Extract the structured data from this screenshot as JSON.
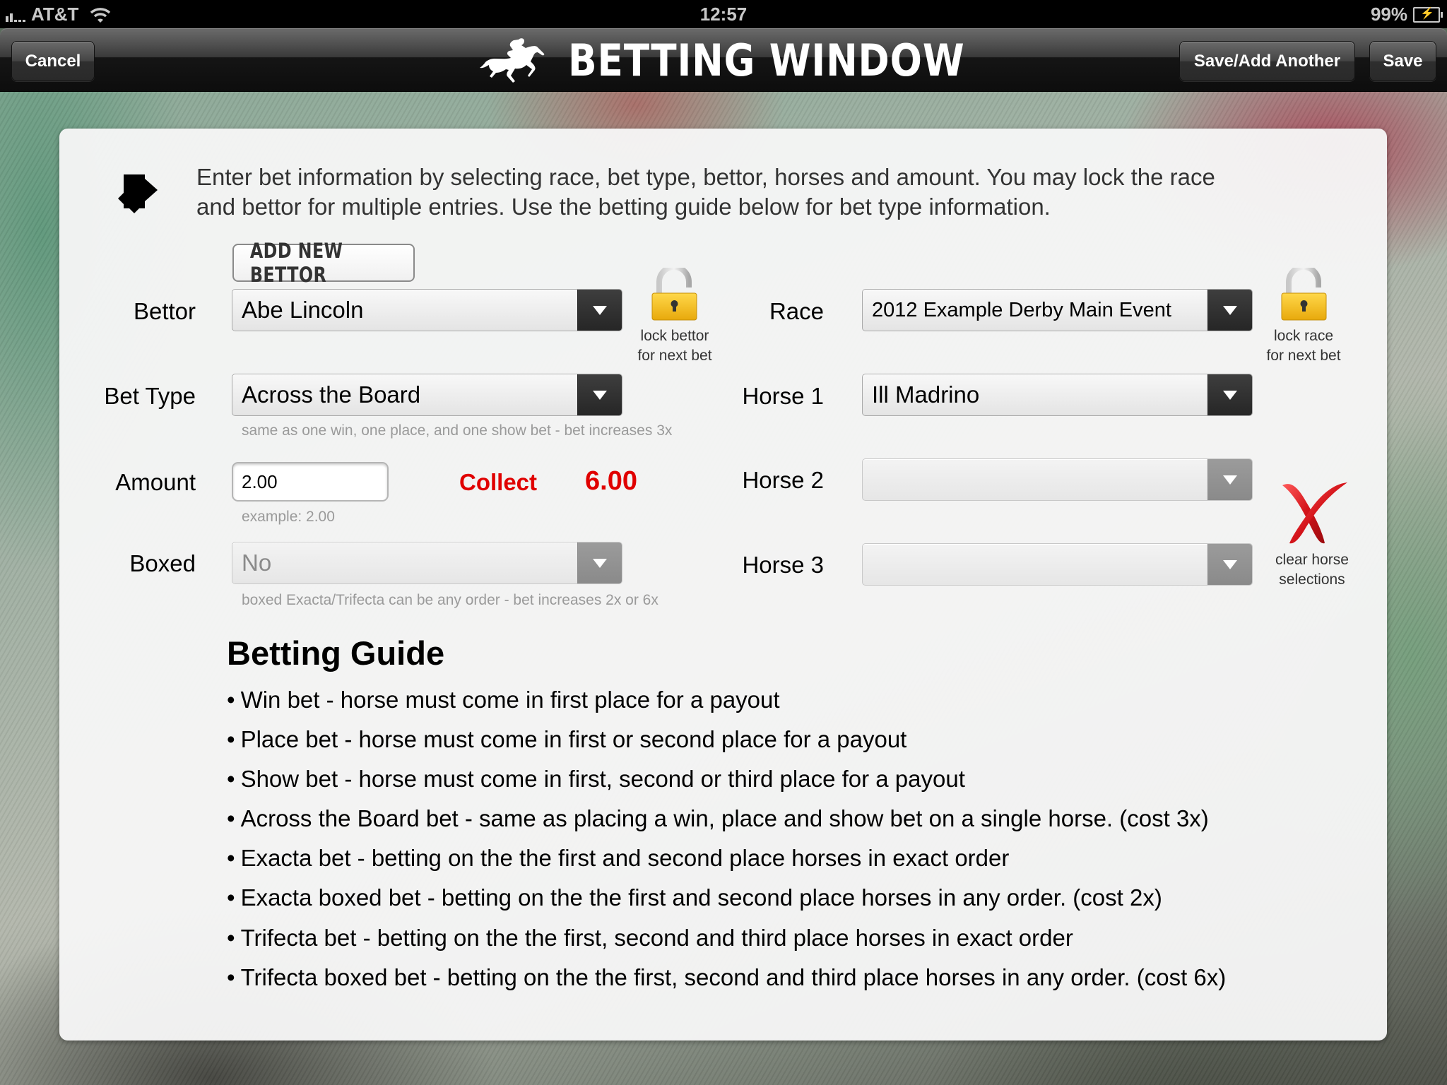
{
  "status_bar": {
    "carrier": "AT&T",
    "time": "12:57",
    "battery": "99%"
  },
  "nav": {
    "cancel_label": "Cancel",
    "title": "BETTING WINDOW",
    "save_add_another_label": "Save/Add Another",
    "save_label": "Save"
  },
  "instructions": {
    "text": "Enter bet information by selecting race, bet type, bettor, horses and amount.  You may lock the race and bettor for multiple entries.  Use the betting guide below for bet type information."
  },
  "form": {
    "add_new_bettor_label": "ADD NEW BETTOR",
    "bettor": {
      "label": "Bettor",
      "value": "Abe Lincoln"
    },
    "lock_bettor": {
      "line1": "lock bettor",
      "line2": "for next bet"
    },
    "bet_type": {
      "label": "Bet Type",
      "value": "Across the Board",
      "helper": "same as one win, one place, and one show bet - bet increases 3x"
    },
    "amount": {
      "label": "Amount",
      "value": "2.00",
      "helper": "example: 2.00"
    },
    "collect": {
      "label": "Collect",
      "value": "6.00"
    },
    "boxed": {
      "label": "Boxed",
      "value": "No",
      "helper": "boxed Exacta/Trifecta can be any order - bet increases 2x or 6x"
    },
    "race": {
      "label": "Race",
      "value": "2012 Example Derby Main Event"
    },
    "lock_race": {
      "line1": "lock race",
      "line2": "for next bet"
    },
    "horse1": {
      "label": "Horse 1",
      "value": "Ill Madrino"
    },
    "horse2": {
      "label": "Horse 2",
      "value": ""
    },
    "horse3": {
      "label": "Horse 3",
      "value": ""
    },
    "clear_horses": {
      "line1": "clear horse",
      "line2": "selections"
    }
  },
  "guide": {
    "title": "Betting Guide",
    "bullet": "•",
    "items": [
      "Win bet - horse must come in first place for a payout",
      "Place bet - horse must come in first or second place for a payout",
      "Show bet - horse must come in first, second or third place for a payout",
      "Across the Board bet - same as placing a win, place and show bet on a single horse.  (cost 3x)",
      "Exacta bet - betting on the the first and second place horses in exact order",
      "Exacta boxed bet - betting on the the first and second place horses in any order.  (cost 2x)",
      "Trifecta bet - betting on the the first, second and third place horses in exact order",
      "Trifecta boxed bet - betting on the the first, second and third place horses in any order.  (cost 6x)"
    ]
  },
  "colors": {
    "collect_red": "#e00000",
    "lock_gold": "#f4c21f",
    "clear_x_red": "#d4141a",
    "nav_dark": "#0d0d0d"
  }
}
